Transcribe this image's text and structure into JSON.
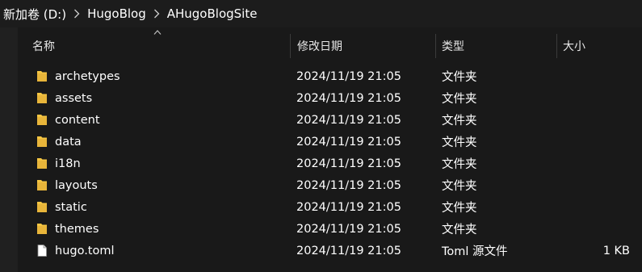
{
  "breadcrumb": {
    "items": [
      "新加卷 (D:)",
      "HugoBlog",
      "AHugoBlogSite"
    ]
  },
  "columns": {
    "name": "名称",
    "date": "修改日期",
    "type": "类型",
    "size": "大小"
  },
  "files": [
    {
      "name": "archetypes",
      "date": "2024/11/19 21:05",
      "type": "文件夹",
      "size": "",
      "icon": "folder-icon"
    },
    {
      "name": "assets",
      "date": "2024/11/19 21:05",
      "type": "文件夹",
      "size": "",
      "icon": "folder-icon"
    },
    {
      "name": "content",
      "date": "2024/11/19 21:05",
      "type": "文件夹",
      "size": "",
      "icon": "folder-icon"
    },
    {
      "name": "data",
      "date": "2024/11/19 21:05",
      "type": "文件夹",
      "size": "",
      "icon": "folder-icon"
    },
    {
      "name": "i18n",
      "date": "2024/11/19 21:05",
      "type": "文件夹",
      "size": "",
      "icon": "folder-icon"
    },
    {
      "name": "layouts",
      "date": "2024/11/19 21:05",
      "type": "文件夹",
      "size": "",
      "icon": "folder-icon"
    },
    {
      "name": "static",
      "date": "2024/11/19 21:05",
      "type": "文件夹",
      "size": "",
      "icon": "folder-icon"
    },
    {
      "name": "themes",
      "date": "2024/11/19 21:05",
      "type": "文件夹",
      "size": "",
      "icon": "folder-icon"
    },
    {
      "name": "hugo.toml",
      "date": "2024/11/19 21:05",
      "type": "Toml 源文件",
      "size": "1 KB",
      "icon": "file-icon"
    }
  ],
  "colors": {
    "background": "#191919",
    "folder": "#f4c542",
    "text": "#ffffff"
  }
}
